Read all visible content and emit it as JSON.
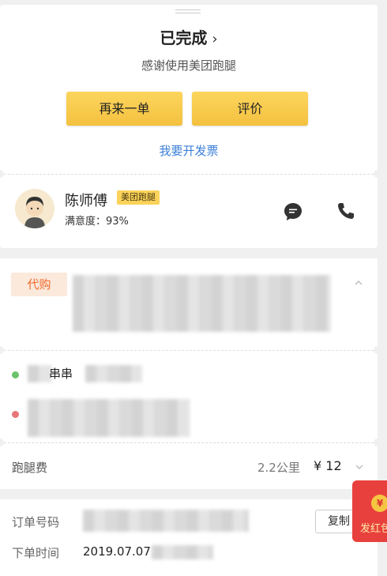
{
  "status": {
    "title": "已完成",
    "chevron": "›",
    "thanks": "感谢使用美团跑腿"
  },
  "actions": {
    "reorder_label": "再来一单",
    "review_label": "评价",
    "invoice_link": "我要开发票"
  },
  "courier": {
    "name": "陈师傅",
    "badge": "美团跑腿",
    "satisfaction": "满意度：93%",
    "icons": [
      "chat-icon",
      "phone-icon"
    ]
  },
  "order_detail": {
    "tag": "代购",
    "address_partial": "串串",
    "fee_label": "跑腿费",
    "distance": "2.2公里",
    "price": "¥ 12"
  },
  "order_info": {
    "order_no_label": "订单号码",
    "copy_label": "复制",
    "time_label": "下单时间",
    "time_value": "2019.07.07"
  },
  "redpacket": {
    "coin": "¥",
    "label": "发红包"
  },
  "colors": {
    "accent_yellow": "#f4c13f",
    "link_blue": "#3b7fd8",
    "tag_orange": "#f06a2c",
    "redpacket": "#e8413d"
  }
}
